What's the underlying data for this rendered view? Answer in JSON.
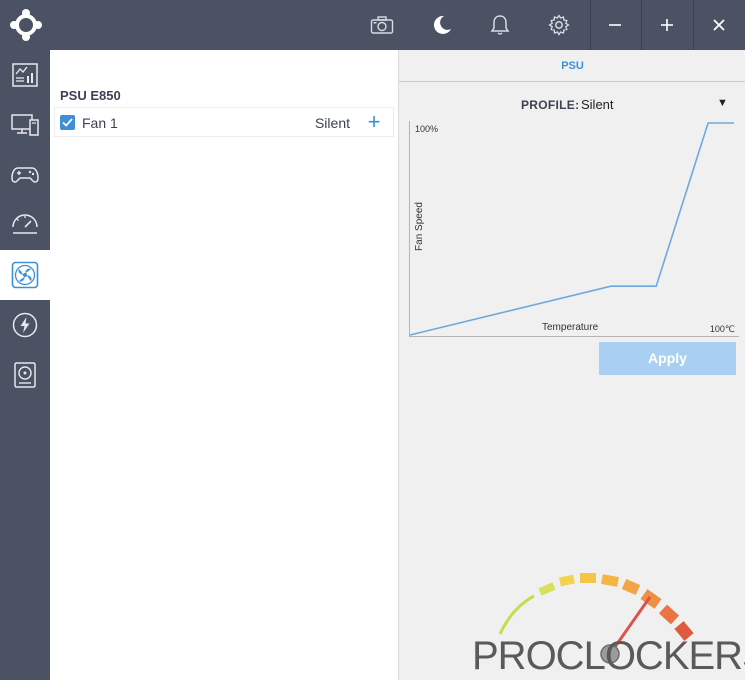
{
  "topbar": {
    "icons": [
      "app-logo",
      "camera-icon",
      "moon-icon",
      "bell-icon",
      "gear-icon",
      "minimize-icon",
      "maximize-icon",
      "close-icon"
    ]
  },
  "sidebar": {
    "items": [
      {
        "icon": "dashboard-icon",
        "active": false
      },
      {
        "icon": "system-monitor-icon",
        "active": false
      },
      {
        "icon": "gamepad-icon",
        "active": false
      },
      {
        "icon": "gauge-icon",
        "active": false
      },
      {
        "icon": "fan-icon",
        "active": true
      },
      {
        "icon": "lightning-icon",
        "active": false
      },
      {
        "icon": "hard-drive-icon",
        "active": false
      }
    ]
  },
  "device": {
    "title": "PSU E850",
    "fans": [
      {
        "name": "Fan 1",
        "profile": "Silent",
        "checked": true,
        "add_label": "+"
      }
    ]
  },
  "panel": {
    "tab": "PSU",
    "profile_label": "PROFILE:",
    "profile_value": "Silent",
    "profile_caret": "▼",
    "graph": {
      "y_top_label": "100%",
      "y_axis_label": "Fan Speed",
      "x_axis_label": "Temperature",
      "x_right_label": "100℃"
    },
    "apply_label": "Apply"
  },
  "chart_data": {
    "type": "line",
    "x": [
      0,
      62,
      68,
      76,
      92,
      100
    ],
    "y": [
      0,
      23,
      23,
      23,
      100,
      100
    ],
    "xlim": [
      0,
      100
    ],
    "ylim": [
      0,
      100
    ]
  },
  "watermark": {
    "text": "PROCLOCKERS"
  },
  "colors": {
    "sidebar_bg": "#4a5263",
    "accent": "#3d8fd6",
    "apply_bg": "#a9cff3",
    "curve": "#6ea9de"
  }
}
